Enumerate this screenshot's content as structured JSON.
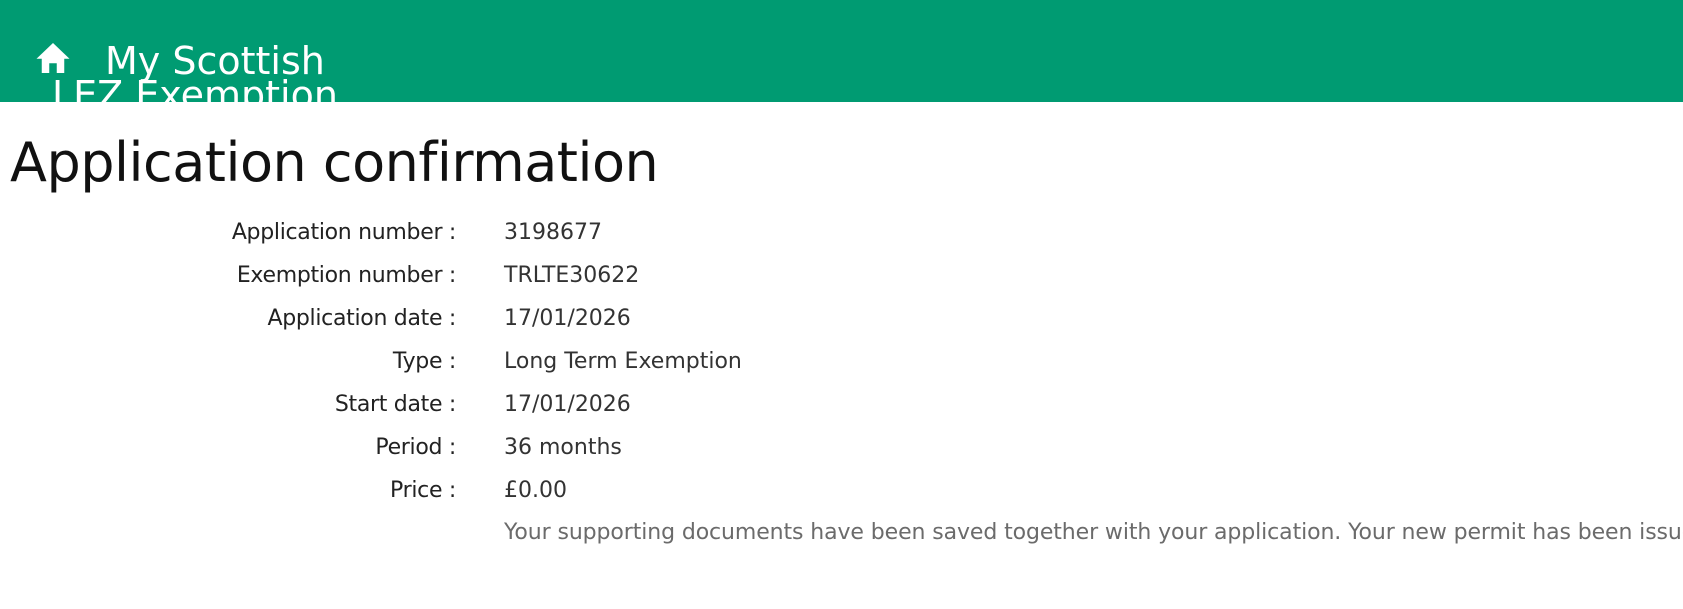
{
  "header": {
    "home_icon": "home-icon",
    "brand_line1": "My Scottish",
    "brand_line2": "LEZ Exemption",
    "background_color": "#009b72"
  },
  "page": {
    "title": "Application confirmation"
  },
  "details": [
    {
      "label": "Application number :",
      "value": "3198677"
    },
    {
      "label": "Exemption number :",
      "value": "TRLTE30622"
    },
    {
      "label": "Application date :",
      "value": "17/01/2026"
    },
    {
      "label": "Type :",
      "value": "Long Term Exemption"
    },
    {
      "label": "Start date :",
      "value": "17/01/2026"
    },
    {
      "label": "Period :",
      "value": "36 months"
    },
    {
      "label": "Price :",
      "value": "£0.00"
    }
  ],
  "note": "Your supporting documents have been saved together with your application. Your new permit has been issued."
}
